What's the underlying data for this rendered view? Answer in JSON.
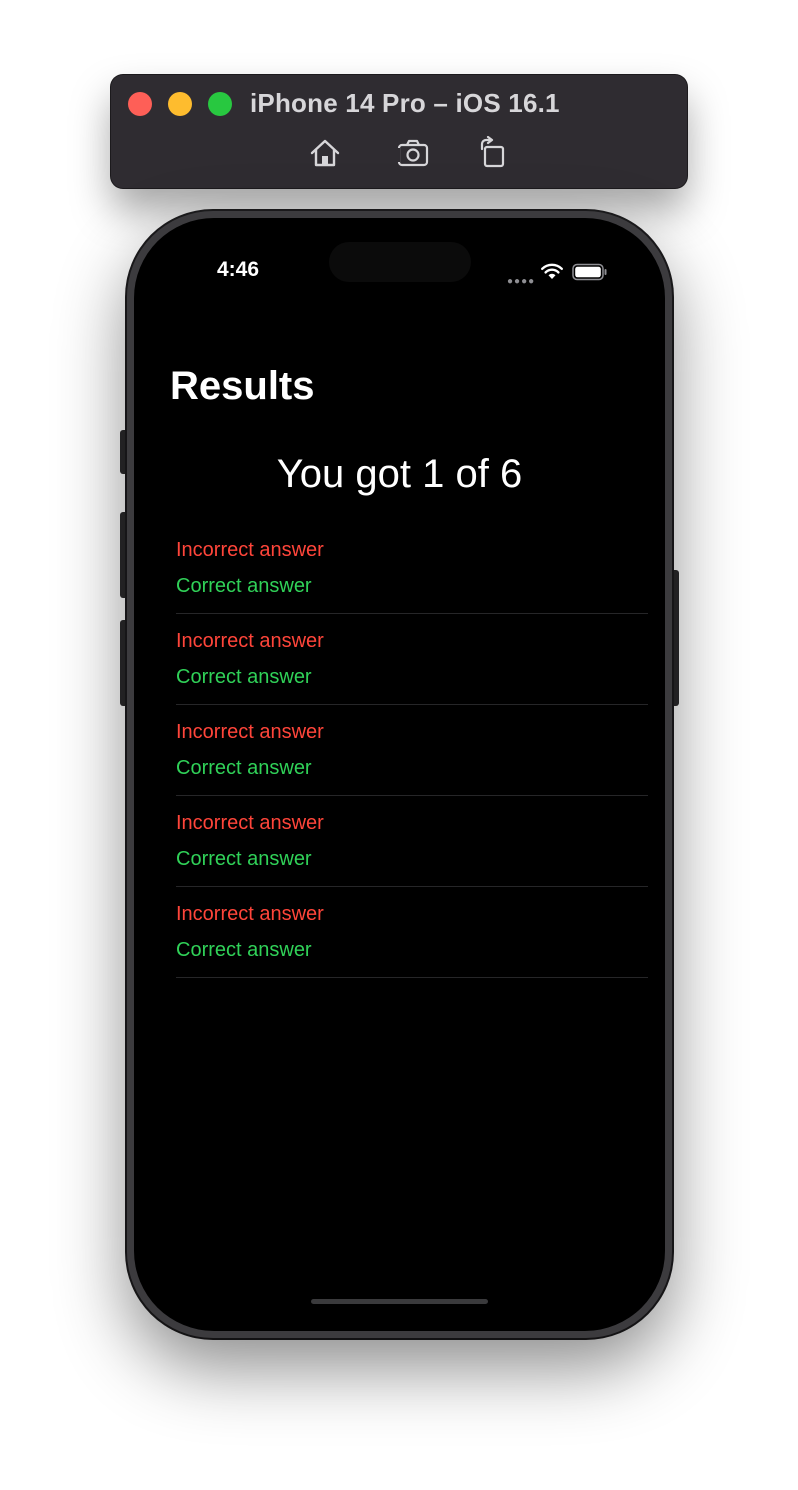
{
  "simulator": {
    "title": "iPhone 14 Pro – iOS 16.1",
    "toolbar_icons": [
      "home-icon",
      "screenshot-icon",
      "rotate-icon"
    ]
  },
  "status_bar": {
    "time": "4:46",
    "icons": [
      "cellular-dots-icon",
      "wifi-icon",
      "battery-icon"
    ]
  },
  "screen": {
    "title": "Results",
    "score_text": "You got 1 of 6",
    "answers": [
      {
        "incorrect": "Incorrect answer",
        "correct": "Correct answer"
      },
      {
        "incorrect": "Incorrect answer",
        "correct": "Correct answer"
      },
      {
        "incorrect": "Incorrect answer",
        "correct": "Correct answer"
      },
      {
        "incorrect": "Incorrect answer",
        "correct": "Correct answer"
      },
      {
        "incorrect": "Incorrect answer",
        "correct": "Correct answer"
      }
    ]
  },
  "colors": {
    "incorrect": "#ff453a",
    "correct": "#30d158",
    "background": "#000000",
    "title_bar": "#2f2c31"
  }
}
